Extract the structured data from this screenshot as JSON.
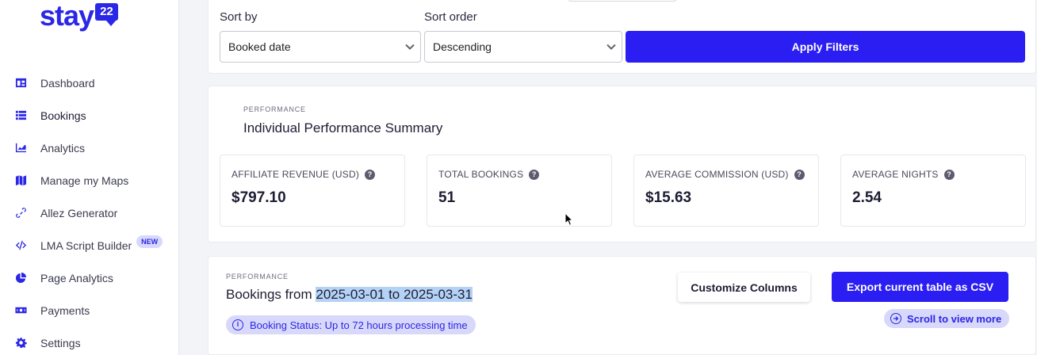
{
  "sidebar": {
    "logo_text": "stay",
    "logo_badge": "22",
    "items": [
      {
        "label": "Dashboard",
        "icon": "dashboard-icon"
      },
      {
        "label": "Bookings",
        "icon": "list-icon"
      },
      {
        "label": "Analytics",
        "icon": "chart-icon"
      },
      {
        "label": "Manage my Maps",
        "icon": "map-icon"
      },
      {
        "label": "Allez Generator",
        "icon": "link-icon"
      },
      {
        "label": "LMA Script Builder",
        "icon": "code-icon",
        "badge": "NEW"
      },
      {
        "label": "Page Analytics",
        "icon": "pie-chart-icon"
      },
      {
        "label": "Payments",
        "icon": "money-icon"
      },
      {
        "label": "Settings",
        "icon": "gear-icon"
      }
    ]
  },
  "filters": {
    "sort_by_label": "Sort by",
    "sort_by_value": "Booked date",
    "sort_order_label": "Sort order",
    "sort_order_value": "Descending",
    "apply_label": "Apply Filters"
  },
  "summary": {
    "eyebrow": "PERFORMANCE",
    "title": "Individual Performance Summary",
    "stats": [
      {
        "label": "AFFILIATE REVENUE (USD)",
        "value": "$797.10"
      },
      {
        "label": "TOTAL BOOKINGS",
        "value": "51"
      },
      {
        "label": "AVERAGE COMMISSION (USD)",
        "value": "$15.63"
      },
      {
        "label": "AVERAGE NIGHTS",
        "value": "2.54"
      }
    ],
    "help_glyph": "?"
  },
  "bookings": {
    "eyebrow": "PERFORMANCE",
    "title_prefix": "Bookings from ",
    "date_range": "2025-03-01 to 2025-03-31",
    "status_pill": "Booking Status: Up to 72 hours processing time",
    "info_glyph": "i",
    "customize_label": "Customize Columns",
    "export_label": "Export current table as CSV",
    "scroll_label": "Scroll to view more"
  },
  "colors": {
    "accent": "#2b1ef2",
    "brand": "#2b27e6",
    "highlight": "#b4d2f5",
    "pill_bg": "#d8d8fb"
  }
}
